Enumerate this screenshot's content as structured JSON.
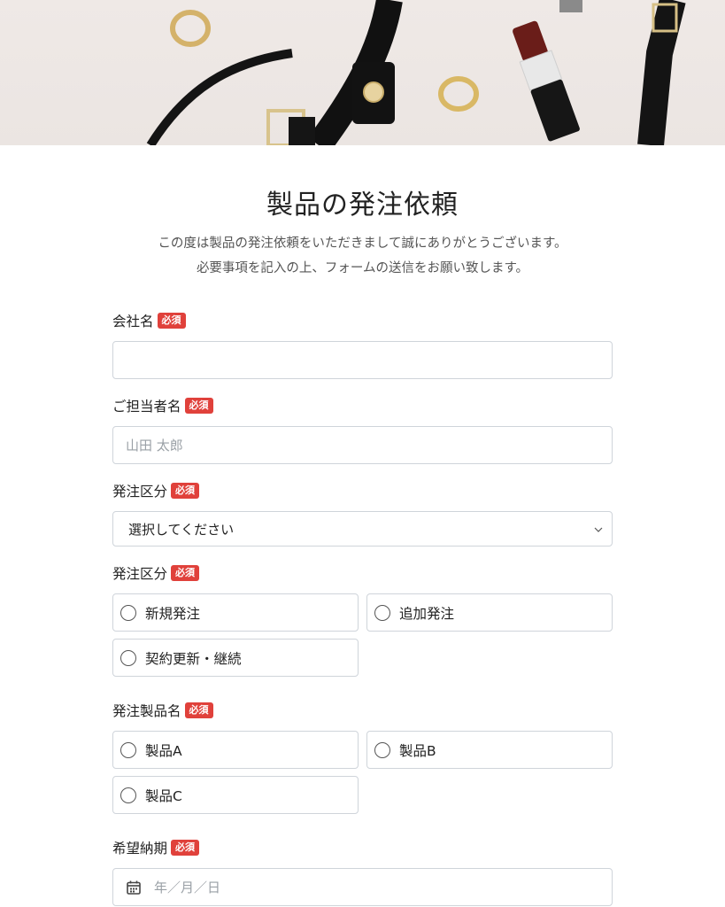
{
  "hero": {
    "alt": "アクセサリー・ベルト・口紅の写真"
  },
  "form": {
    "title": "製品の発注依頼",
    "lead_line1": "この度は製品の発注依頼をいただきまして誠にありがとうございます。",
    "lead_line2": "必要事項を記入の上、フォームの送信をお願い致します。",
    "required_badge": "必須",
    "fields": {
      "company": {
        "label": "会社名",
        "value": ""
      },
      "contact": {
        "label": "ご担当者名",
        "placeholder": "山田 太郎"
      },
      "order_type_select": {
        "label": "発注区分",
        "selected": "選択してください"
      },
      "order_type_radio": {
        "label": "発注区分",
        "options": [
          "新規発注",
          "追加発注",
          "契約更新・継続"
        ]
      },
      "product": {
        "label": "発注製品名",
        "options": [
          "製品A",
          "製品B",
          "製品C"
        ]
      },
      "delivery_date": {
        "label": "希望納期",
        "placeholder": "年／月／日"
      }
    }
  },
  "colors": {
    "required_badge": "#e0413b",
    "border": "#cfd4da"
  }
}
